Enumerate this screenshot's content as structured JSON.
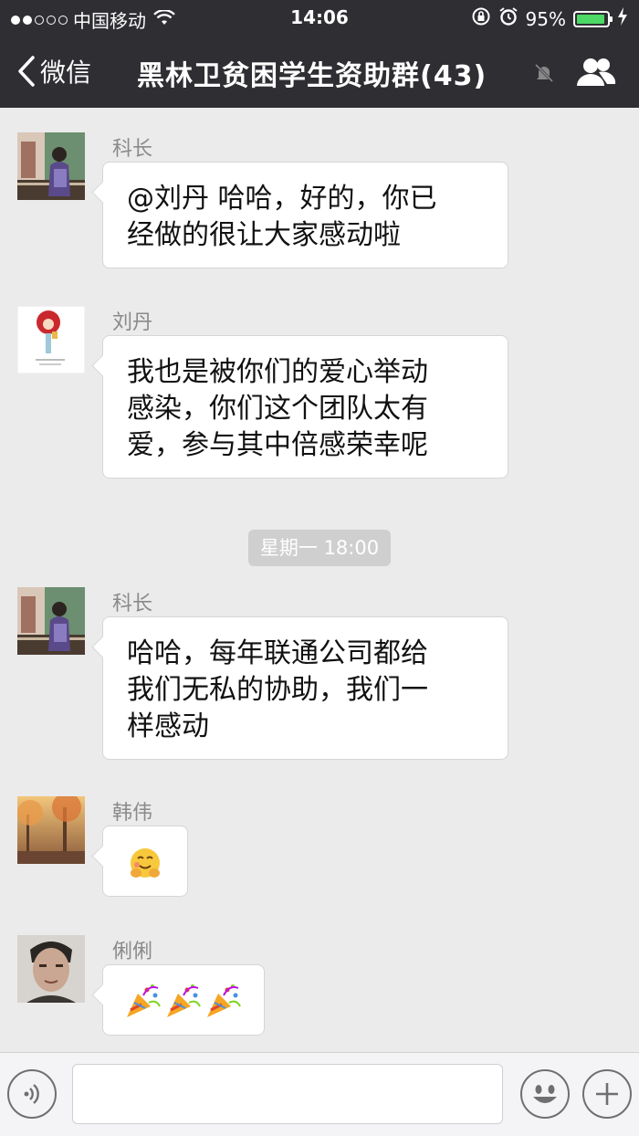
{
  "status_bar": {
    "carrier": "中国移动",
    "time": "14:06",
    "battery": "95%",
    "battery_level": 0.95
  },
  "nav": {
    "back_label": "微信",
    "title": "黑林卫贫困学生资助群(43)"
  },
  "messages": [
    {
      "sender": "科长",
      "lines": [
        "@刘丹 哈哈，好的，你已",
        "经做的很让大家感动啦"
      ]
    },
    {
      "sender": "刘丹",
      "lines": [
        "我也是被你们的爱心举动",
        "感染，你们这个团队太有",
        "爱，参与其中倍感荣幸呢"
      ]
    },
    {
      "sender": "科长",
      "lines": [
        "哈哈，每年联通公司都给",
        "我们无私的协助，我们一",
        "样感动"
      ]
    },
    {
      "sender": "韩伟",
      "emoji": [
        "hug-emoji"
      ]
    },
    {
      "sender": "俐俐",
      "emoji": [
        "party-popper-emoji",
        "party-popper-emoji",
        "party-popper-emoji"
      ]
    }
  ],
  "timestamp": "星期一 18:00",
  "colors": {
    "header_bg": "#2e2e33",
    "chat_bg": "#ebebeb",
    "bubble_bg": "#ffffff",
    "battery_green": "#4cd964"
  }
}
